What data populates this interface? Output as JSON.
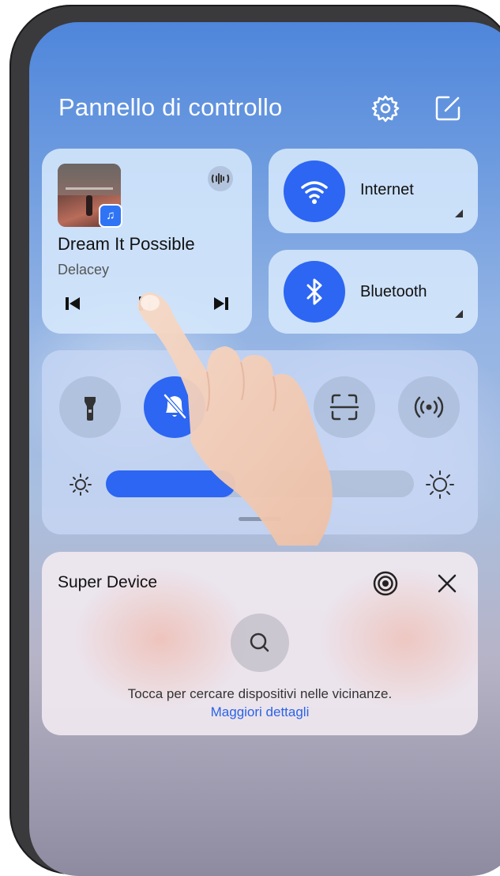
{
  "header": {
    "title": "Pannello di controllo",
    "settings_icon": "gear-icon",
    "edit_icon": "edit-icon"
  },
  "music": {
    "song": "Dream It Possible",
    "artist": "Delacey",
    "app_icon": "music-note-icon",
    "cast_icon": "audio-output-icon"
  },
  "tiles": [
    {
      "label": "Internet",
      "icon": "wifi-icon",
      "active": true
    },
    {
      "label": "Bluetooth",
      "icon": "bluetooth-icon",
      "active": true
    }
  ],
  "toggles": [
    {
      "icon": "flashlight-icon",
      "active": false
    },
    {
      "icon": "mute-bell-icon",
      "active": true
    },
    {
      "icon": "scan-icon",
      "active": false
    },
    {
      "icon": "hotspot-icon",
      "active": false
    }
  ],
  "brightness": {
    "level": 0.42
  },
  "super_device": {
    "title": "Super Device",
    "hint": "Tocca per cercare dispositivi nelle vicinanze.",
    "link": "Maggiori dettagli"
  },
  "colors": {
    "accent": "#2c66f2",
    "link": "#2a63e6"
  }
}
